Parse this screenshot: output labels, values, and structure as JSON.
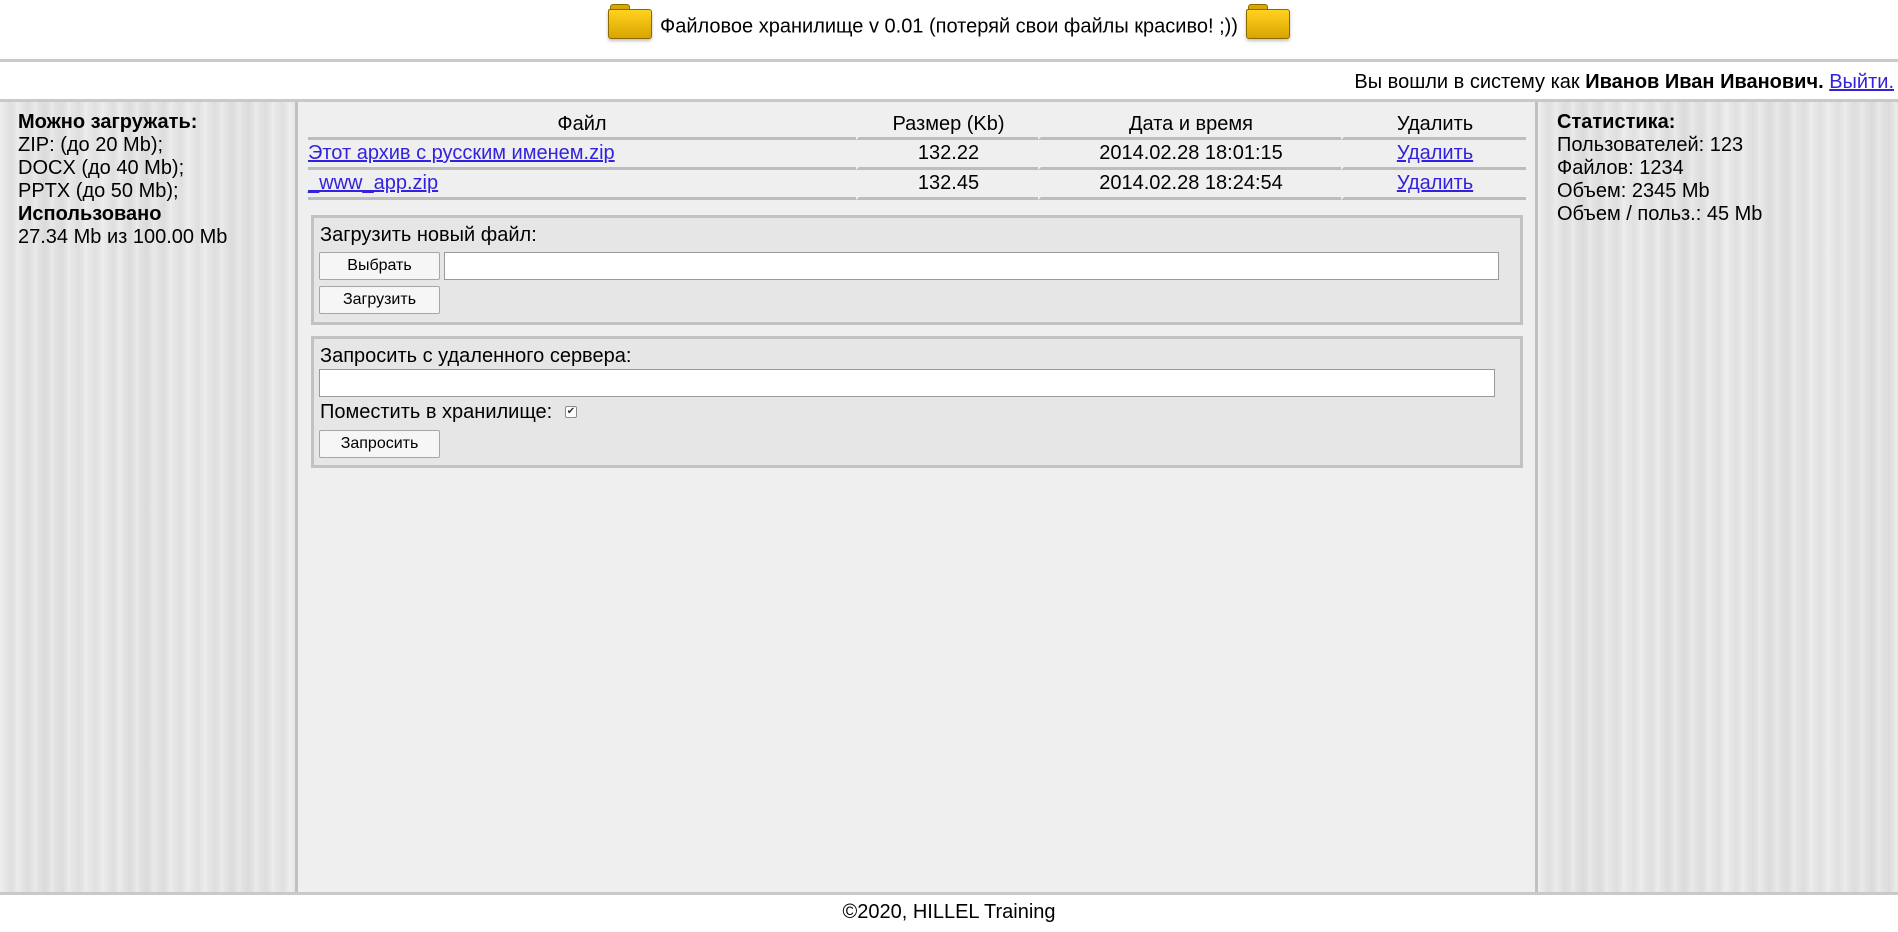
{
  "header": {
    "title": "Файловое хранилище v 0.01 (потеряй свои файлы красиво! ;))",
    "left_icon": "folder-icon",
    "right_icon": "folder-icon",
    "folder_color": "#f2c200"
  },
  "userbar": {
    "prefix": "Вы вошли в систему как",
    "user_name": "Иванов Иван Иванович.",
    "logout_label": "Выйти."
  },
  "left_panel": {
    "allowed_title": "Можно загружать:",
    "allowed": [
      "ZIP: (до 20 Mb);",
      "DOCX (до 40 Mb);",
      "PPTX (до 50 Mb);"
    ],
    "used_title": "Использовано",
    "used_value": "27.34 Mb из 100.00 Mb"
  },
  "files_table": {
    "headers": [
      "Файл",
      "Размер (Kb)",
      "Дата и время",
      "Удалить"
    ],
    "rows": [
      {
        "name": "Этот архив с русским именем.zip",
        "size": "132.22",
        "datetime": "2014.02.28 18:01:15",
        "delete": "Удалить"
      },
      {
        "name": "_www_app.zip",
        "size": "132.45",
        "datetime": "2014.02.28 18:24:54",
        "delete": "Удалить"
      }
    ]
  },
  "upload_form": {
    "label": "Загрузить новый файл:",
    "choose_button": "Выбрать",
    "file_value": "",
    "upload_button": "Загрузить"
  },
  "remote_form": {
    "label": "Запросить с удаленного сервера:",
    "url_value": "",
    "store_label": "Поместить в хранилище:",
    "store_checked": true,
    "request_button": "Запросить"
  },
  "right_panel": {
    "title": "Статистика:",
    "users": "Пользователей: 123",
    "files": "Файлов: 1234",
    "volume": "Объем: 2345 Mb",
    "volume_per_user": "Объем / польз.: 45 Mb"
  },
  "footer": {
    "text": "©2020, HILLEL Training"
  },
  "colors": {
    "link": "#3322dd",
    "border": "#c2c2c2",
    "panel_bg": "#efefef"
  }
}
